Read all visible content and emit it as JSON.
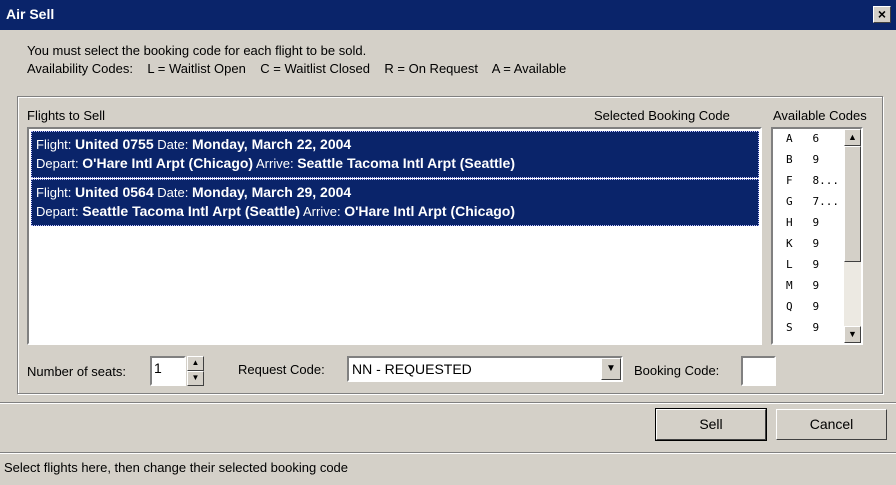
{
  "window": {
    "title": "Air Sell",
    "close_glyph": "×"
  },
  "instructions": {
    "line1": "You must select the booking code for each flight to be sold.",
    "line2": "Availability Codes:    L = Waitlist Open    C = Waitlist Closed    R = On Request    A = Available"
  },
  "headers": {
    "flights": "Flights to Sell",
    "selected_code": "Selected Booking Code",
    "available_codes": "Available Codes"
  },
  "flights": [
    {
      "flight_label": "Flight:",
      "flight": "United 0755",
      "date_label": "Date:",
      "date": "Monday, March 22, 2004",
      "depart_label": "Depart:",
      "depart": "O'Hare Intl Arpt (Chicago)",
      "arrive_label": "Arrive:",
      "arrive": "Seattle Tacoma Intl Arpt (Seattle)"
    },
    {
      "flight_label": "Flight:",
      "flight": "United 0564",
      "date_label": "Date:",
      "date": "Monday, March 29, 2004",
      "depart_label": "Depart:",
      "depart": "Seattle Tacoma Intl Arpt (Seattle)",
      "arrive_label": "Arrive:",
      "arrive": "O'Hare Intl Arpt (Chicago)"
    }
  ],
  "available_codes": [
    {
      "code": "A",
      "count": "6"
    },
    {
      "code": "B",
      "count": "9"
    },
    {
      "code": "F",
      "count": "8..."
    },
    {
      "code": "G",
      "count": "7..."
    },
    {
      "code": "H",
      "count": "9"
    },
    {
      "code": "K",
      "count": "9"
    },
    {
      "code": "L",
      "count": "9"
    },
    {
      "code": "M",
      "count": "9"
    },
    {
      "code": "Q",
      "count": "9"
    },
    {
      "code": "S",
      "count": "9"
    }
  ],
  "controls": {
    "seats_label": "Number of seats:",
    "seats_value": "1",
    "request_label": "Request Code:",
    "request_value": "NN - REQUESTED",
    "booking_label": "Booking Code:",
    "booking_value": ""
  },
  "buttons": {
    "sell": "Sell",
    "cancel": "Cancel"
  },
  "status": "Select flights here, then change their selected booking code",
  "colors": {
    "titlebar": "#0a246a",
    "selection": "#0a246a",
    "face": "#d4d0c8"
  },
  "icons": {
    "close": "close-icon",
    "scroll_up": "scroll-up-icon",
    "scroll_down": "scroll-down-icon",
    "spin_up": "spin-up-icon",
    "spin_down": "spin-down-icon",
    "dropdown": "dropdown-arrow-icon"
  }
}
